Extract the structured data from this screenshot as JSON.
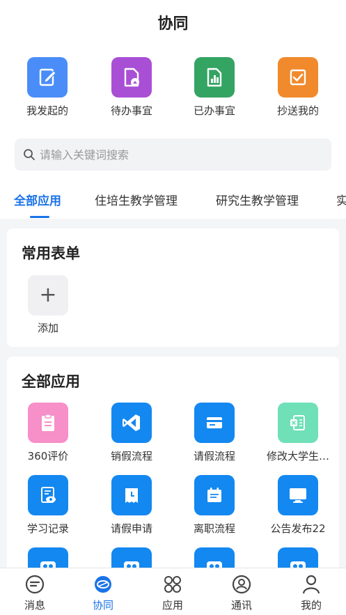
{
  "header": {
    "title": "协同"
  },
  "quick_actions": [
    {
      "label": "我发起的",
      "icon": "edit-doc-icon",
      "color": "#4a8df8"
    },
    {
      "label": "待办事宜",
      "icon": "pending-doc-icon",
      "color": "#a94fd6"
    },
    {
      "label": "已办事宜",
      "icon": "chart-doc-icon",
      "color": "#34a463"
    },
    {
      "label": "抄送我的",
      "icon": "check-box-icon",
      "color": "#f08a2c"
    }
  ],
  "search": {
    "placeholder": "请输入关键词搜索",
    "value": ""
  },
  "tabs": [
    {
      "label": "全部应用",
      "active": true
    },
    {
      "label": "住培生教学管理",
      "active": false
    },
    {
      "label": "研究生教学管理",
      "active": false
    },
    {
      "label": "实",
      "active": false
    }
  ],
  "common_forms": {
    "title": "常用表单",
    "add_label": "添加",
    "add_symbol": "+"
  },
  "all_apps": {
    "title": "全部应用",
    "items": [
      {
        "label": "360评价",
        "icon": "clipboard-icon",
        "color": "#f78fc9"
      },
      {
        "label": "销假流程",
        "icon": "vscode-icon",
        "color": "#1388f0"
      },
      {
        "label": "请假流程",
        "icon": "card-icon",
        "color": "#1388f0"
      },
      {
        "label": "修改大学生…",
        "icon": "transfer-doc-icon",
        "color": "#6fe0b8"
      },
      {
        "label": "学习记录",
        "icon": "eye-doc-icon",
        "color": "#1388f0"
      },
      {
        "label": "请假申请",
        "icon": "calendar-icon",
        "color": "#1388f0"
      },
      {
        "label": "离职流程",
        "icon": "notepad-icon",
        "color": "#1388f0"
      },
      {
        "label": "公告发布22",
        "icon": "monitor-icon",
        "color": "#1388f0"
      },
      {
        "label": "",
        "icon": "chat-bubble-icon",
        "color": "#1388f0"
      },
      {
        "label": "",
        "icon": "chat-bubble-icon",
        "color": "#1388f0"
      },
      {
        "label": "",
        "icon": "chat-bubble-icon",
        "color": "#1388f0"
      },
      {
        "label": "",
        "icon": "chat-bubble-icon",
        "color": "#1388f0"
      }
    ]
  },
  "bottom_nav": [
    {
      "label": "消息",
      "icon": "message-icon",
      "active": false
    },
    {
      "label": "协同",
      "icon": "collaborate-icon",
      "active": true
    },
    {
      "label": "应用",
      "icon": "apps-icon",
      "active": false
    },
    {
      "label": "通讯",
      "icon": "contacts-icon",
      "active": false
    },
    {
      "label": "我的",
      "icon": "profile-icon",
      "active": false
    }
  ],
  "colors": {
    "accent": "#1a73e8"
  }
}
